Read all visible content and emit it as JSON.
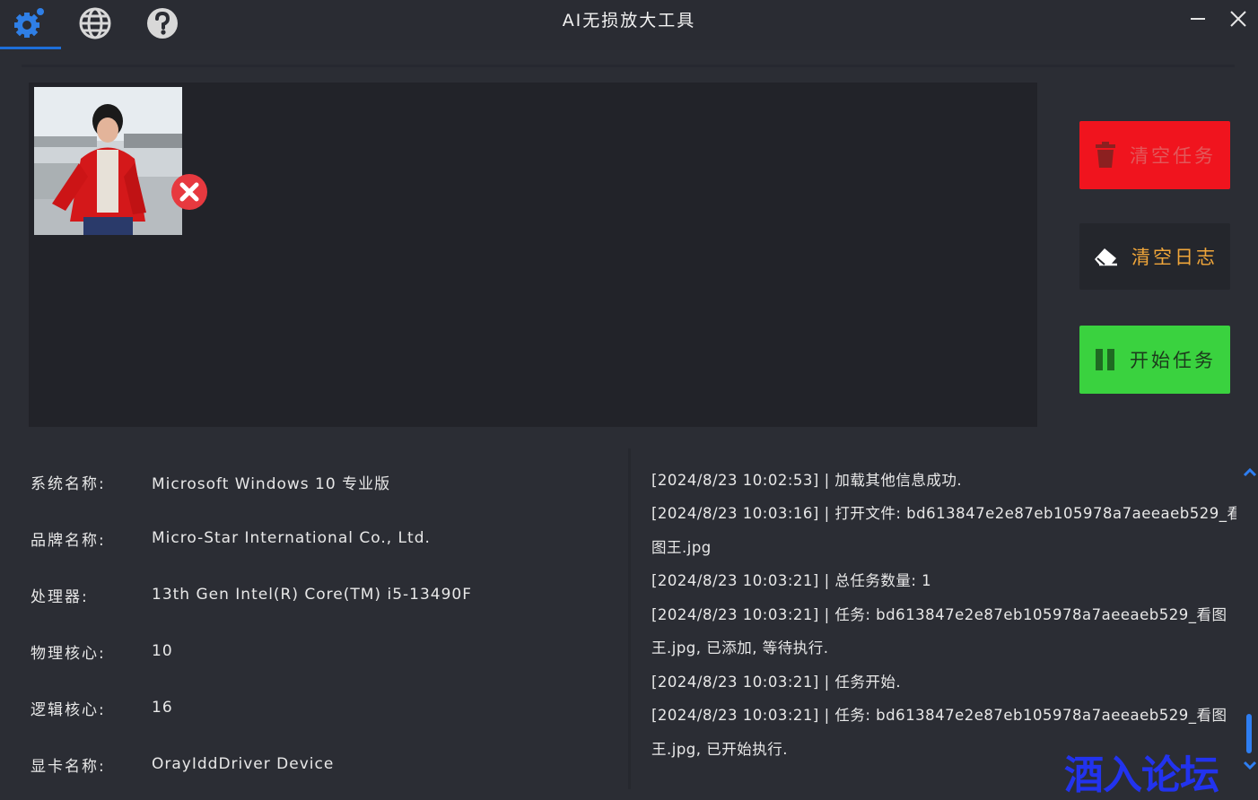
{
  "app": {
    "title": "AI无损放大工具"
  },
  "toolbar": {
    "settings_icon": "gear-icon",
    "language_icon": "globe-icon",
    "help_icon": "question-circle-icon",
    "active_color": "#1e6fd9"
  },
  "window_controls": {
    "minimize_icon": "minimize-icon",
    "close_icon": "close-icon"
  },
  "image_list": {
    "items": [
      {
        "remove_icon": "remove-x-circle-icon",
        "thumbnail": "woman-red-jacket-photo"
      }
    ]
  },
  "actions": {
    "clear_tasks": {
      "label": "清空任务",
      "icon": "trash-icon",
      "color": "#f0141e"
    },
    "clear_log": {
      "label": "清空日志",
      "icon": "eraser-icon",
      "color": "#24262c"
    },
    "start_tasks": {
      "label": "开始任务",
      "icon": "pause-icon",
      "color": "#3ad23f"
    }
  },
  "system_info": [
    {
      "label": "系统名称:",
      "value": "Microsoft Windows 10 专业版"
    },
    {
      "label": "品牌名称:",
      "value": "Micro-Star International Co., Ltd."
    },
    {
      "label": "处理器:",
      "value": "13th Gen Intel(R) Core(TM) i5-13490F"
    },
    {
      "label": "物理核心:",
      "value": "10"
    },
    {
      "label": "逻辑核心:",
      "value": "16"
    },
    {
      "label": "显卡名称:",
      "value": "OrayIddDriver Device"
    }
  ],
  "log": {
    "lines": [
      "[2024/8/23 10:02:53] | 加载其他信息成功.",
      "[2024/8/23 10:03:16] | 打开文件: bd613847e2e87eb105978a7aeeaeb529_看",
      "图王.jpg",
      "[2024/8/23 10:03:21] | 总任务数量: 1",
      "[2024/8/23 10:03:21] | 任务: bd613847e2e87eb105978a7aeeaeb529_看图",
      "王.jpg, 已添加, 等待执行.",
      "[2024/8/23 10:03:21] | 任务开始.",
      "[2024/8/23 10:03:21] | 任务: bd613847e2e87eb105978a7aeeaeb529_看图",
      "王.jpg, 已开始执行."
    ]
  },
  "watermark": {
    "text": "酒入论坛"
  }
}
